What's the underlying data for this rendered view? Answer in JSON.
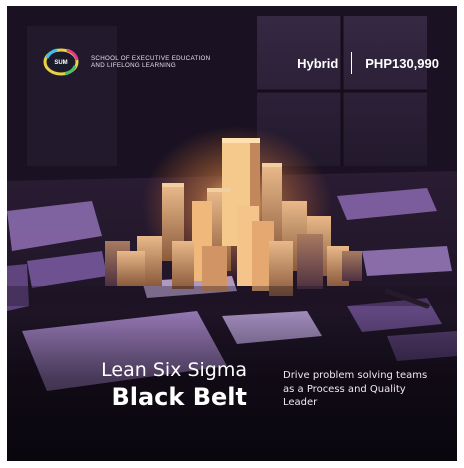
{
  "logo": {
    "mark_text": "SUM",
    "text": "SCHOOL OF EXECUTIVE EDUCATION AND LIFELONG LEARNING"
  },
  "header": {
    "mode": "Hybrid",
    "price": "PHP130,990"
  },
  "course": {
    "title_line1": "Lean Six Sigma",
    "title_line2": "Black Belt",
    "subtitle": "Drive problem solving teams as a Process and Quality Leader"
  },
  "colors": {
    "glow": "#ffb25a",
    "accent_purple": "#a66bd8",
    "text": "#ffffff"
  }
}
